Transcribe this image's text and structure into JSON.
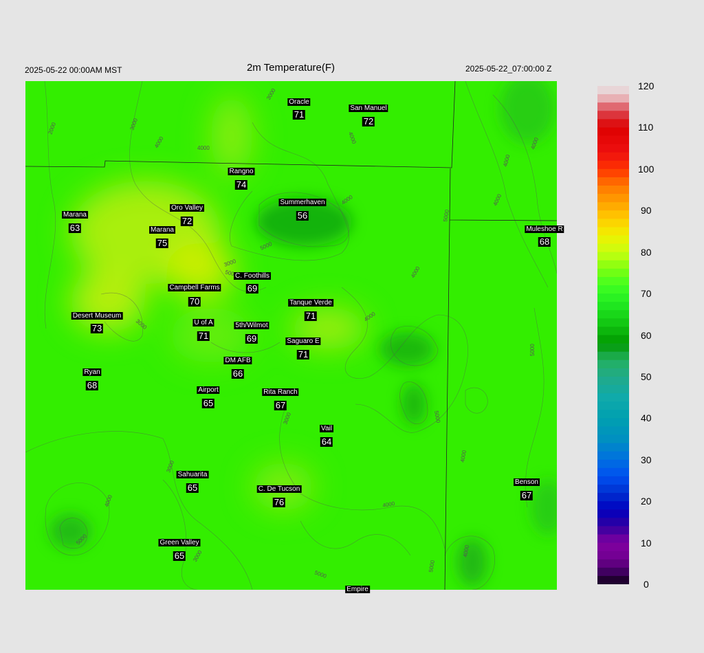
{
  "header": {
    "local_time": "2025-05-22 00:00AM MST",
    "title": "2m Temperature(F)",
    "utc_time": "2025-05-22_07:00:00 Z"
  },
  "stations": [
    {
      "name": "Oracle",
      "temp": "71"
    },
    {
      "name": "San Manuel",
      "temp": "72"
    },
    {
      "name": "Rangno",
      "temp": "74"
    },
    {
      "name": "Summerhaven",
      "temp": "56"
    },
    {
      "name": "Oro Valley",
      "temp": "72"
    },
    {
      "name": "Marana",
      "temp": "63"
    },
    {
      "name": "Marana",
      "temp": "75"
    },
    {
      "name": "Muleshoe R",
      "temp": "68"
    },
    {
      "name": "C. Foothills",
      "temp": "69"
    },
    {
      "name": "Campbell Farms",
      "temp": "70"
    },
    {
      "name": "Tanque Verde",
      "temp": "71"
    },
    {
      "name": "Desert Museum",
      "temp": "73"
    },
    {
      "name": "U of A",
      "temp": "71"
    },
    {
      "name": "5th/Wilmot",
      "temp": "69"
    },
    {
      "name": "Saguaro E",
      "temp": "71"
    },
    {
      "name": "DM AFB",
      "temp": "66"
    },
    {
      "name": "Ryan",
      "temp": "68"
    },
    {
      "name": "Airport",
      "temp": "65"
    },
    {
      "name": "Rita Ranch",
      "temp": "67"
    },
    {
      "name": "Vail",
      "temp": "64"
    },
    {
      "name": "Sahuarita",
      "temp": "65"
    },
    {
      "name": "C. De Tucson",
      "temp": "76"
    },
    {
      "name": "Benson",
      "temp": "67"
    },
    {
      "name": "Green Valley",
      "temp": "65"
    },
    {
      "name": "Empire",
      "temp": ""
    }
  ],
  "contour_labels": [
    "2000",
    "3000",
    "4000",
    "3000",
    "4000",
    "4000",
    "5000",
    "5000",
    "4000",
    "4000",
    "5000",
    "4000",
    "3000",
    "4000",
    "4000",
    "5000",
    "4000",
    "3000",
    "3000",
    "4000",
    "5000",
    "4000",
    "3000",
    "4000",
    "5000",
    "5000",
    "5000",
    "4000",
    "3000"
  ],
  "colorbar": {
    "ticks": [
      "120",
      "110",
      "100",
      "90",
      "80",
      "70",
      "60",
      "50",
      "40",
      "30",
      "20",
      "10",
      "0"
    ],
    "min": 0,
    "max": 120
  },
  "colors": {
    "background": "#e5e5e5",
    "field_base": "#33ee00"
  }
}
